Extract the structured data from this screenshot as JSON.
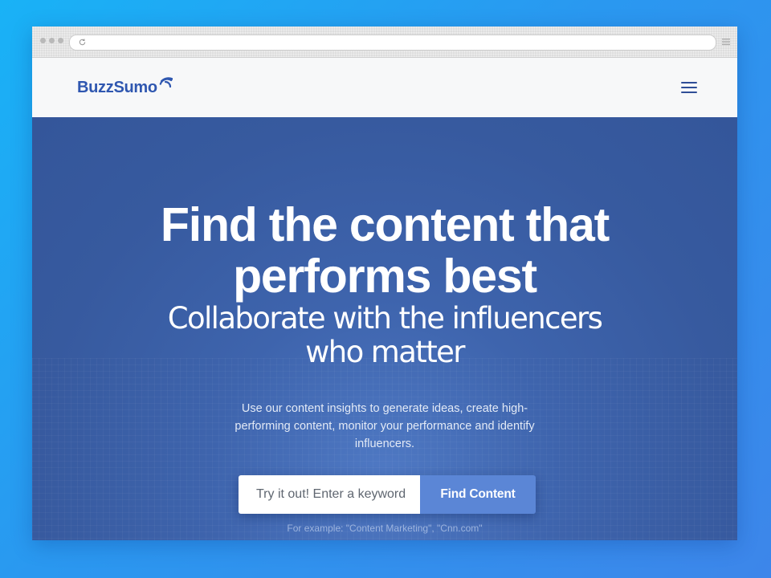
{
  "brand": {
    "name": "BuzzSumo",
    "color": "#2f57b0"
  },
  "hero": {
    "headline_line1": "Find the content that",
    "headline_line2": "performs best",
    "subheadline_line1": "Collaborate with the influencers",
    "subheadline_line2": "who matter",
    "description": "Use our content insights to generate ideas, create high-performing content, monitor your performance and identify influencers.",
    "background_color": "#3a5fa6"
  },
  "search": {
    "placeholder": "Try it out! Enter a keyword",
    "button_label": "Find Content",
    "button_color": "#5b86d6",
    "example": "For example: \"Content Marketing\", \"Cnn.com\""
  },
  "icons": {
    "menu": "hamburger-icon",
    "reload": "reload-icon",
    "logo_signal": "signal-waves-icon",
    "browser_menu": "browser-menu-icon"
  }
}
